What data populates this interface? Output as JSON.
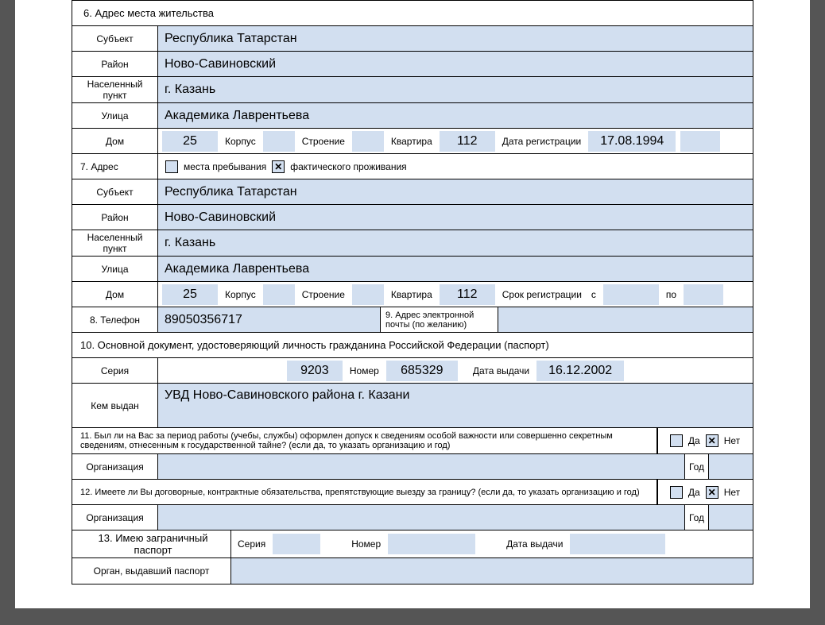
{
  "section6": {
    "title": "6. Адрес места жительства",
    "labels": {
      "subject": "Субъект",
      "district": "Район",
      "locality": "Населенный пункт",
      "street": "Улица",
      "house": "Дом",
      "korpus": "Корпус",
      "building": "Строение",
      "apartment": "Квартира",
      "regdate": "Дата регистрации"
    },
    "subject": "Республика Татарстан",
    "district": "Ново-Савиновский",
    "locality": "г. Казань",
    "street": "Академика Лаврентьева",
    "house": "25",
    "korpus": "",
    "building": "",
    "apartment": "112",
    "regdate": "17.08.1994"
  },
  "section7": {
    "title": "7. Адрес",
    "stay_label": "места пребывания",
    "fact_label": "фактического проживания",
    "stay_checked": false,
    "fact_checked": true,
    "labels": {
      "subject": "Субъект",
      "district": "Район",
      "locality": "Населенный пункт",
      "street": "Улица",
      "house": "Дом",
      "korpus": "Корпус",
      "building": "Строение",
      "apartment": "Квартира",
      "regperiod": "Срок регистрации",
      "from": "с",
      "to": "по"
    },
    "subject": "Республика Татарстан",
    "district": "Ново-Савиновский",
    "locality": "г. Казань",
    "street": "Академика Лаврентьева",
    "house": "25",
    "korpus": "",
    "building": "",
    "apartment": "112",
    "reg_from": "",
    "reg_to": ""
  },
  "section8": {
    "label": "8. Телефон",
    "value": "89050356717"
  },
  "section9": {
    "label": "9. Адрес электронной почты (по желанию)",
    "value": ""
  },
  "section10": {
    "title": "10. Основной документ, удостоверяющий личность гражданина Российской Федерации (паспорт)",
    "labels": {
      "series": "Серия",
      "number": "Номер",
      "date": "Дата выдачи",
      "issued_by": "Кем выдан"
    },
    "series": "9203",
    "number": "685329",
    "date": "16.12.2002",
    "issued_by": "УВД Ново-Савиновского района г. Казани"
  },
  "section11": {
    "text": "11. Был ли на Вас за период работы (учебы, службы) оформлен допуск к сведениям особой важности или совершенно секретным сведениям, отнесенным к государственной тайне? (если да, то указать организацию и год)",
    "yes_label": "Да",
    "no_label": "Нет",
    "org_label": "Организация",
    "year_label": "Год",
    "yes": false,
    "no": true,
    "org": "",
    "year": ""
  },
  "section12": {
    "text": "12. Имеете ли Вы договорные, контрактные обязательства, препятствующие выезду за границу? (если да, то указать организацию и год)",
    "yes_label": "Да",
    "no_label": "Нет",
    "org_label": "Организация",
    "year_label": "Год",
    "yes": false,
    "no": true,
    "org": "",
    "year": ""
  },
  "section13": {
    "title": "13. Имею заграничный паспорт",
    "labels": {
      "series": "Серия",
      "number": "Номер",
      "date": "Дата выдачи",
      "issued_by": "Орган, выдавший паспорт"
    },
    "series": "",
    "number": "",
    "date": "",
    "issued_by": ""
  }
}
